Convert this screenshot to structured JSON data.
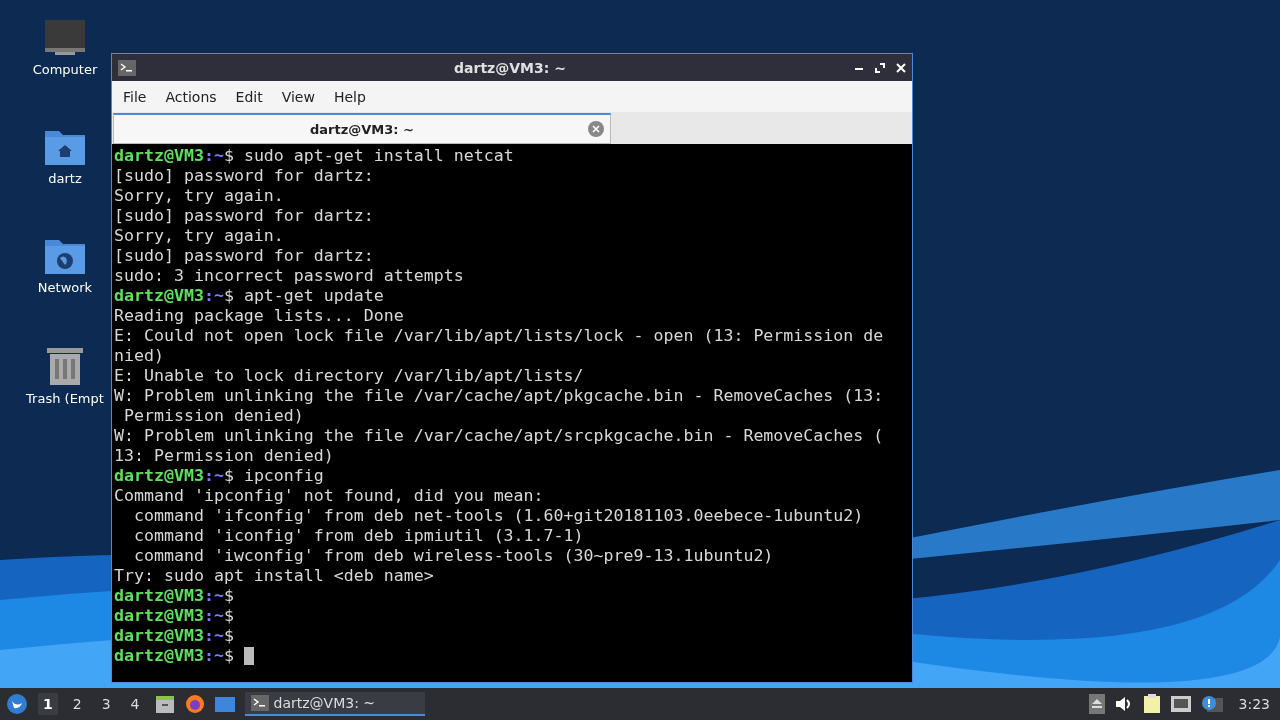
{
  "desktop_icons": [
    {
      "kind": "computer",
      "label": "Computer"
    },
    {
      "kind": "home",
      "label": "dartz"
    },
    {
      "kind": "network",
      "label": "Network"
    },
    {
      "kind": "trash",
      "label": "Trash (Empt"
    }
  ],
  "window": {
    "title": "dartz@VM3: ~"
  },
  "menu": [
    "File",
    "Actions",
    "Edit",
    "View",
    "Help"
  ],
  "tabs": [
    {
      "label": "dartz@VM3: ~",
      "selected": true
    }
  ],
  "terminal": {
    "lines": [
      {
        "kind": "prompt",
        "user": "dartz@VM3",
        "path": ":~",
        "sign": "$",
        "command": "sudo apt-get install netcat"
      },
      {
        "kind": "output",
        "text": "[sudo] password for dartz:"
      },
      {
        "kind": "output",
        "text": "Sorry, try again."
      },
      {
        "kind": "output",
        "text": "[sudo] password for dartz:"
      },
      {
        "kind": "output",
        "text": "Sorry, try again."
      },
      {
        "kind": "output",
        "text": "[sudo] password for dartz:"
      },
      {
        "kind": "output",
        "text": "sudo: 3 incorrect password attempts"
      },
      {
        "kind": "prompt",
        "user": "dartz@VM3",
        "path": ":~",
        "sign": "$",
        "command": "apt-get update"
      },
      {
        "kind": "output",
        "text": "Reading package lists... Done"
      },
      {
        "kind": "output",
        "text": "E: Could not open lock file /var/lib/apt/lists/lock - open (13: Permission de"
      },
      {
        "kind": "output",
        "text": "nied)"
      },
      {
        "kind": "output",
        "text": "E: Unable to lock directory /var/lib/apt/lists/"
      },
      {
        "kind": "output",
        "text": "W: Problem unlinking the file /var/cache/apt/pkgcache.bin - RemoveCaches (13:"
      },
      {
        "kind": "output",
        "text": " Permission denied)"
      },
      {
        "kind": "output",
        "text": "W: Problem unlinking the file /var/cache/apt/srcpkgcache.bin - RemoveCaches ("
      },
      {
        "kind": "output",
        "text": "13: Permission denied)"
      },
      {
        "kind": "prompt",
        "user": "dartz@VM3",
        "path": ":~",
        "sign": "$",
        "command": "ipconfig"
      },
      {
        "kind": "output",
        "text": "Command 'ipconfig' not found, did you mean:"
      },
      {
        "kind": "output",
        "text": "  command 'ifconfig' from deb net-tools (1.60+git20181103.0eebece-1ubuntu2)"
      },
      {
        "kind": "output",
        "text": "  command 'iconfig' from deb ipmiutil (3.1.7-1)"
      },
      {
        "kind": "output",
        "text": "  command 'iwconfig' from deb wireless-tools (30~pre9-13.1ubuntu2)"
      },
      {
        "kind": "output",
        "text": "Try: sudo apt install <deb name>"
      },
      {
        "kind": "prompt",
        "user": "dartz@VM3",
        "path": ":~",
        "sign": "$"
      },
      {
        "kind": "prompt",
        "user": "dartz@VM3",
        "path": ":~",
        "sign": "$"
      },
      {
        "kind": "prompt",
        "user": "dartz@VM3",
        "path": ":~",
        "sign": "$"
      },
      {
        "kind": "prompt",
        "user": "dartz@VM3",
        "path": ":~",
        "sign": "$",
        "cursor": true
      }
    ]
  },
  "taskbar": {
    "workspaces": [
      {
        "label": "1",
        "selected": true
      },
      {
        "label": "2",
        "selected": false
      },
      {
        "label": "3",
        "selected": false
      },
      {
        "label": "4",
        "selected": false
      }
    ],
    "launchers": [
      {
        "kind": "files"
      },
      {
        "kind": "browser"
      },
      {
        "kind": "desktop"
      }
    ],
    "tasks": [
      {
        "label": "dartz@VM3: ~",
        "selected": true
      }
    ],
    "tray": [
      {
        "kind": "eject"
      },
      {
        "kind": "volume"
      },
      {
        "kind": "clipboard"
      },
      {
        "kind": "network"
      },
      {
        "kind": "updates"
      }
    ],
    "clock": "3:23"
  }
}
